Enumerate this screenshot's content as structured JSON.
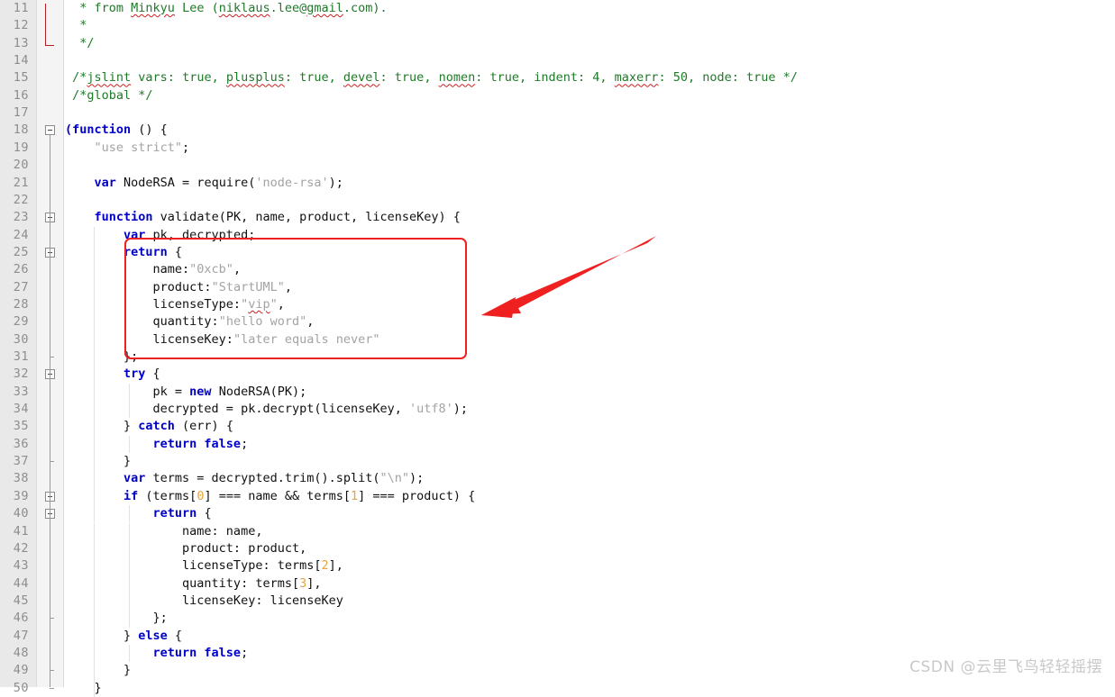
{
  "editor": {
    "language": "JavaScript",
    "first_line": 11,
    "last_line": 50,
    "colors": {
      "keyword": "#0000c8",
      "comment": "#1f7a28",
      "string": "#a3a3a3",
      "number": "#e8a33d",
      "plain": "#101010",
      "gutter_background": "#e9e9e9",
      "line_number": "#8d8d8d",
      "annotation_red": "#ef2020",
      "spellcheck_underline": "#cc2020",
      "watermark": "#c9c9c9"
    }
  },
  "annotation": {
    "box_label": "highlighted-return-object",
    "box_covers_lines": "25-31",
    "arrow_label": "red-arrow-pointing-to-return-object"
  },
  "watermark": {
    "text": "CSDN @云里飞鸟轻轻摇摆"
  },
  "lines": [
    {
      "n": 11,
      "indent_guides": [],
      "fold": null,
      "tokens": [
        {
          "t": "cm",
          "s": "  * from "
        },
        {
          "t": "cm sq",
          "s": "Minkyu"
        },
        {
          "t": "cm",
          "s": " Lee ("
        },
        {
          "t": "cm sq",
          "s": "niklaus"
        },
        {
          "t": "cm",
          "s": ".lee@"
        },
        {
          "t": "cm sq",
          "s": "gmail"
        },
        {
          "t": "cm",
          "s": ".com)."
        }
      ]
    },
    {
      "n": 12,
      "indent_guides": [],
      "fold": null,
      "tokens": [
        {
          "t": "cm",
          "s": "  *"
        }
      ]
    },
    {
      "n": 13,
      "indent_guides": [],
      "fold": null,
      "tokens": [
        {
          "t": "cm",
          "s": "  */"
        }
      ]
    },
    {
      "n": 14,
      "indent_guides": [],
      "fold": null,
      "tokens": []
    },
    {
      "n": 15,
      "indent_guides": [],
      "fold": null,
      "tokens": [
        {
          "t": "cm",
          "s": " /*"
        },
        {
          "t": "cm sq",
          "s": "jslint"
        },
        {
          "t": "cm",
          "s": " vars: true, "
        },
        {
          "t": "cm sq",
          "s": "plusplus"
        },
        {
          "t": "cm",
          "s": ": true, "
        },
        {
          "t": "cm sq",
          "s": "devel"
        },
        {
          "t": "cm",
          "s": ": true, "
        },
        {
          "t": "cm sq",
          "s": "nomen"
        },
        {
          "t": "cm",
          "s": ": true, indent: 4, "
        },
        {
          "t": "cm sq",
          "s": "maxerr"
        },
        {
          "t": "cm",
          "s": ": 50, node: true */"
        }
      ]
    },
    {
      "n": 16,
      "indent_guides": [],
      "fold": null,
      "tokens": [
        {
          "t": "cm",
          "s": " /*global */"
        }
      ]
    },
    {
      "n": 17,
      "indent_guides": [],
      "fold": null,
      "tokens": []
    },
    {
      "n": 18,
      "indent_guides": [],
      "fold": "box",
      "tokens": [
        {
          "t": "kw",
          "s": "(function"
        },
        {
          "t": "pl",
          "s": " () {"
        }
      ]
    },
    {
      "n": 19,
      "indent_guides": [],
      "fold": null,
      "tokens": [
        {
          "t": "str",
          "s": "    \"use strict\""
        },
        {
          "t": "pl",
          "s": ";"
        }
      ]
    },
    {
      "n": 20,
      "indent_guides": [],
      "fold": null,
      "tokens": []
    },
    {
      "n": 21,
      "indent_guides": [],
      "fold": null,
      "tokens": [
        {
          "t": "kw",
          "s": "    var"
        },
        {
          "t": "pl",
          "s": " NodeRSA = require("
        },
        {
          "t": "str",
          "s": "'node-rsa'"
        },
        {
          "t": "pl",
          "s": ");"
        }
      ]
    },
    {
      "n": 22,
      "indent_guides": [],
      "fold": null,
      "tokens": []
    },
    {
      "n": 23,
      "indent_guides": [],
      "fold": "box",
      "tokens": [
        {
          "t": "kw",
          "s": "    function"
        },
        {
          "t": "pl",
          "s": " validate(PK, name, product, licenseKey) {"
        }
      ]
    },
    {
      "n": 24,
      "indent_guides": [
        104
      ],
      "fold": null,
      "tokens": [
        {
          "t": "kw",
          "s": "        var"
        },
        {
          "t": "pl",
          "s": " pk, decrypted;"
        }
      ]
    },
    {
      "n": 25,
      "indent_guides": [
        104
      ],
      "fold": "box",
      "tokens": [
        {
          "t": "kw",
          "s": "        return"
        },
        {
          "t": "pl",
          "s": " {"
        }
      ]
    },
    {
      "n": 26,
      "indent_guides": [
        104
      ],
      "fold": null,
      "tokens": [
        {
          "t": "pl",
          "s": "            name:"
        },
        {
          "t": "str",
          "s": "\"0xcb\""
        },
        {
          "t": "pl",
          "s": ","
        }
      ]
    },
    {
      "n": 27,
      "indent_guides": [
        104
      ],
      "fold": null,
      "tokens": [
        {
          "t": "pl",
          "s": "            product:"
        },
        {
          "t": "str",
          "s": "\"StartUML\""
        },
        {
          "t": "pl",
          "s": ","
        }
      ]
    },
    {
      "n": 28,
      "indent_guides": [
        104
      ],
      "fold": null,
      "tokens": [
        {
          "t": "pl",
          "s": "            licenseType:"
        },
        {
          "t": "str",
          "s": "\""
        },
        {
          "t": "str sq",
          "s": "vip"
        },
        {
          "t": "str",
          "s": "\""
        },
        {
          "t": "pl",
          "s": ","
        }
      ]
    },
    {
      "n": 29,
      "indent_guides": [
        104
      ],
      "fold": null,
      "tokens": [
        {
          "t": "pl",
          "s": "            quantity:"
        },
        {
          "t": "str",
          "s": "\"hello word\""
        },
        {
          "t": "pl",
          "s": ","
        }
      ]
    },
    {
      "n": 30,
      "indent_guides": [
        104
      ],
      "fold": null,
      "tokens": [
        {
          "t": "pl",
          "s": "            licenseKey:"
        },
        {
          "t": "str",
          "s": "\"later equals never\""
        }
      ]
    },
    {
      "n": 31,
      "indent_guides": [
        104
      ],
      "fold": "tick",
      "tokens": [
        {
          "t": "pl",
          "s": "        };"
        }
      ]
    },
    {
      "n": 32,
      "indent_guides": [
        104
      ],
      "fold": "box",
      "tokens": [
        {
          "t": "kw",
          "s": "        try"
        },
        {
          "t": "pl",
          "s": " {"
        }
      ]
    },
    {
      "n": 33,
      "indent_guides": [
        104,
        143
      ],
      "fold": null,
      "tokens": [
        {
          "t": "pl",
          "s": "            pk = "
        },
        {
          "t": "kw",
          "s": "new"
        },
        {
          "t": "pl",
          "s": " NodeRSA(PK);"
        }
      ]
    },
    {
      "n": 34,
      "indent_guides": [
        104,
        143
      ],
      "fold": null,
      "tokens": [
        {
          "t": "pl",
          "s": "            decrypted = pk.decrypt(licenseKey, "
        },
        {
          "t": "str",
          "s": "'utf8'"
        },
        {
          "t": "pl",
          "s": ");"
        }
      ]
    },
    {
      "n": 35,
      "indent_guides": [
        104
      ],
      "fold": null,
      "tokens": [
        {
          "t": "pl",
          "s": "        } "
        },
        {
          "t": "kw",
          "s": "catch"
        },
        {
          "t": "pl",
          "s": " (err) {"
        }
      ]
    },
    {
      "n": 36,
      "indent_guides": [
        104,
        143
      ],
      "fold": null,
      "tokens": [
        {
          "t": "kw",
          "s": "            return false"
        },
        {
          "t": "pl",
          "s": ";"
        }
      ]
    },
    {
      "n": 37,
      "indent_guides": [
        104
      ],
      "fold": "tick",
      "tokens": [
        {
          "t": "pl",
          "s": "        }"
        }
      ]
    },
    {
      "n": 38,
      "indent_guides": [
        104
      ],
      "fold": null,
      "tokens": [
        {
          "t": "kw",
          "s": "        var"
        },
        {
          "t": "pl",
          "s": " terms = decrypted.trim().split("
        },
        {
          "t": "str",
          "s": "\"\\n\""
        },
        {
          "t": "pl",
          "s": ");"
        }
      ]
    },
    {
      "n": 39,
      "indent_guides": [
        104
      ],
      "fold": "box",
      "tokens": [
        {
          "t": "kw",
          "s": "        if"
        },
        {
          "t": "pl",
          "s": " (terms["
        },
        {
          "t": "num",
          "s": "0"
        },
        {
          "t": "pl",
          "s": "] === name && terms["
        },
        {
          "t": "num",
          "s": "1"
        },
        {
          "t": "pl",
          "s": "] === product) {"
        }
      ]
    },
    {
      "n": 40,
      "indent_guides": [
        104,
        143
      ],
      "fold": "box",
      "tokens": [
        {
          "t": "kw",
          "s": "            return"
        },
        {
          "t": "pl",
          "s": " {"
        }
      ]
    },
    {
      "n": 41,
      "indent_guides": [
        104,
        143
      ],
      "fold": null,
      "tokens": [
        {
          "t": "pl",
          "s": "                name: name,"
        }
      ]
    },
    {
      "n": 42,
      "indent_guides": [
        104,
        143
      ],
      "fold": null,
      "tokens": [
        {
          "t": "pl",
          "s": "                product: product,"
        }
      ]
    },
    {
      "n": 43,
      "indent_guides": [
        104,
        143
      ],
      "fold": null,
      "tokens": [
        {
          "t": "pl",
          "s": "                licenseType: terms["
        },
        {
          "t": "num",
          "s": "2"
        },
        {
          "t": "pl",
          "s": "],"
        }
      ]
    },
    {
      "n": 44,
      "indent_guides": [
        104,
        143
      ],
      "fold": null,
      "tokens": [
        {
          "t": "pl",
          "s": "                quantity: terms["
        },
        {
          "t": "num",
          "s": "3"
        },
        {
          "t": "pl",
          "s": "],"
        }
      ]
    },
    {
      "n": 45,
      "indent_guides": [
        104,
        143
      ],
      "fold": null,
      "tokens": [
        {
          "t": "pl",
          "s": "                licenseKey: licenseKey"
        }
      ]
    },
    {
      "n": 46,
      "indent_guides": [
        104,
        143
      ],
      "fold": "tick",
      "tokens": [
        {
          "t": "pl",
          "s": "            };"
        }
      ]
    },
    {
      "n": 47,
      "indent_guides": [
        104
      ],
      "fold": null,
      "tokens": [
        {
          "t": "pl",
          "s": "        } "
        },
        {
          "t": "kw",
          "s": "else"
        },
        {
          "t": "pl",
          "s": " {"
        }
      ]
    },
    {
      "n": 48,
      "indent_guides": [
        104,
        143
      ],
      "fold": null,
      "tokens": [
        {
          "t": "kw",
          "s": "            return false"
        },
        {
          "t": "pl",
          "s": ";"
        }
      ]
    },
    {
      "n": 49,
      "indent_guides": [
        104
      ],
      "fold": "tick",
      "tokens": [
        {
          "t": "pl",
          "s": "        }"
        }
      ]
    },
    {
      "n": 50,
      "indent_guides": [
        104
      ],
      "fold": "tick",
      "tokens": [
        {
          "t": "pl",
          "s": "    }"
        }
      ]
    }
  ]
}
